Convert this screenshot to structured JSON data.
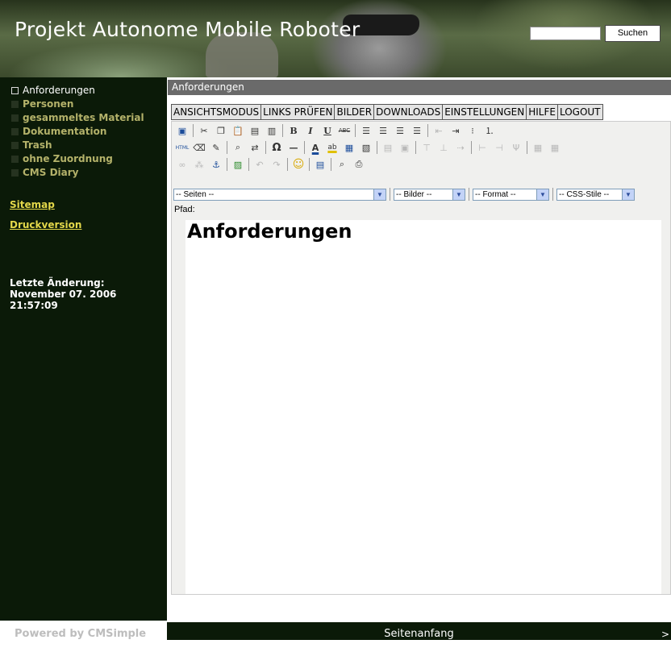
{
  "header": {
    "site_title": "Projekt Autonome Mobile Roboter",
    "search_placeholder": "",
    "search_button": "Suchen"
  },
  "sidebar": {
    "items": [
      {
        "label": "Anforderungen",
        "active": true
      },
      {
        "label": "Personen"
      },
      {
        "label": "gesammeltes Material"
      },
      {
        "label": "Dokumentation"
      },
      {
        "label": "Trash"
      },
      {
        "label": "ohne Zuordnung"
      },
      {
        "label": "CMS Diary"
      }
    ],
    "sitemap": "Sitemap",
    "print": "Druckversion",
    "last_change_label": "Letzte Änderung:",
    "last_change_date": "November 07. 2006",
    "last_change_time": "21:57:09"
  },
  "main": {
    "title": "Anforderungen",
    "admin_menu": [
      "ANSICHTSMODUS",
      "LINKS PRÜFEN",
      "BILDER",
      "DOWNLOADS",
      "EINSTELLUNGEN",
      "HILFE",
      "LOGOUT"
    ],
    "selects": {
      "pages": "-- Seiten --",
      "images": "-- Bilder --",
      "format": "-- Format --",
      "css": "-- CSS-Stile --"
    },
    "path_label": "Pfad:",
    "heading": "Anforderungen",
    "toolbar_text": {
      "bold": "B",
      "italic": "I",
      "underline": "U",
      "strike": "ABC",
      "html": "HTML",
      "omega": "Ω",
      "hr": "—",
      "font_color": "A",
      "highlight": "ab"
    },
    "toolbar_icons": [
      "save-icon",
      "cut-icon",
      "copy-icon",
      "paste-icon",
      "paste-text-icon",
      "paste-word-icon",
      "bold-icon",
      "italic-icon",
      "underline-icon",
      "strikethrough-icon",
      "align-left-icon",
      "align-center-icon",
      "align-right-icon",
      "justify-icon",
      "outdent-icon",
      "indent-icon",
      "bullet-list-icon",
      "numbered-list-icon",
      "html-source-icon",
      "eraser-icon",
      "cleanup-icon",
      "find-icon",
      "replace-icon",
      "special-char-icon",
      "horizontal-rule-icon",
      "font-color-icon",
      "highlight-icon",
      "table-icon",
      "table-props-icon",
      "link-icon",
      "unlink-icon",
      "anchor-icon",
      "image-icon",
      "undo-icon",
      "redo-icon",
      "smiley-icon",
      "date-icon",
      "preview-icon",
      "print-icon"
    ]
  },
  "footer": {
    "powered_by": "Powered by CMSimple",
    "top_link": "Seitenanfang",
    "arrow": ">"
  },
  "colors": {
    "sidebar_bg": "#0b1a08",
    "nav_item": "#b4b26a",
    "side_link": "#e4d84a",
    "title_bar": "#6a6a6a"
  }
}
